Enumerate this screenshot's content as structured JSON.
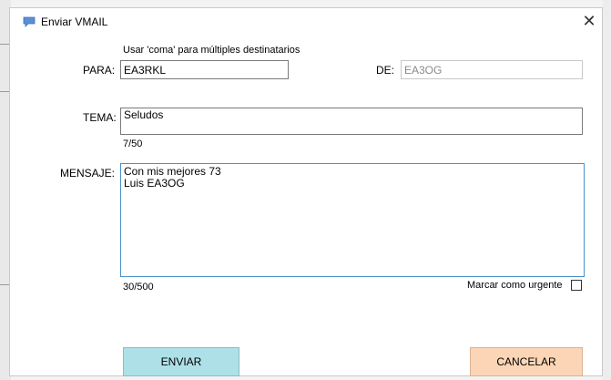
{
  "window": {
    "title": "Enviar VMAIL",
    "close_glyph": "✕"
  },
  "form": {
    "hint": "Usar 'coma' para múltiples destinatarios",
    "para_label": "PARA:",
    "para_value": "EA3RKL",
    "de_label": "DE:",
    "de_value": "EA3OG",
    "tema_label": "TEMA:",
    "tema_value": "Seludos",
    "tema_counter": "7/50",
    "mensaje_label": "MENSAJE:",
    "mensaje_value": "Con mis mejores 73\nLuis EA3OG",
    "mensaje_counter": "30/500",
    "urgent_label": "Marcar como urgente",
    "urgent_checked": false
  },
  "buttons": {
    "send_label": "ENVIAR",
    "cancel_label": "CANCELAR"
  },
  "colors": {
    "send_button": "#aee0e8",
    "cancel_button": "#fbd5b5",
    "message_border": "#4a90c8",
    "title_icon": "#5b8fd6"
  },
  "icons": {
    "title_icon": "chat-bubble-icon",
    "close_icon": "close-icon"
  }
}
